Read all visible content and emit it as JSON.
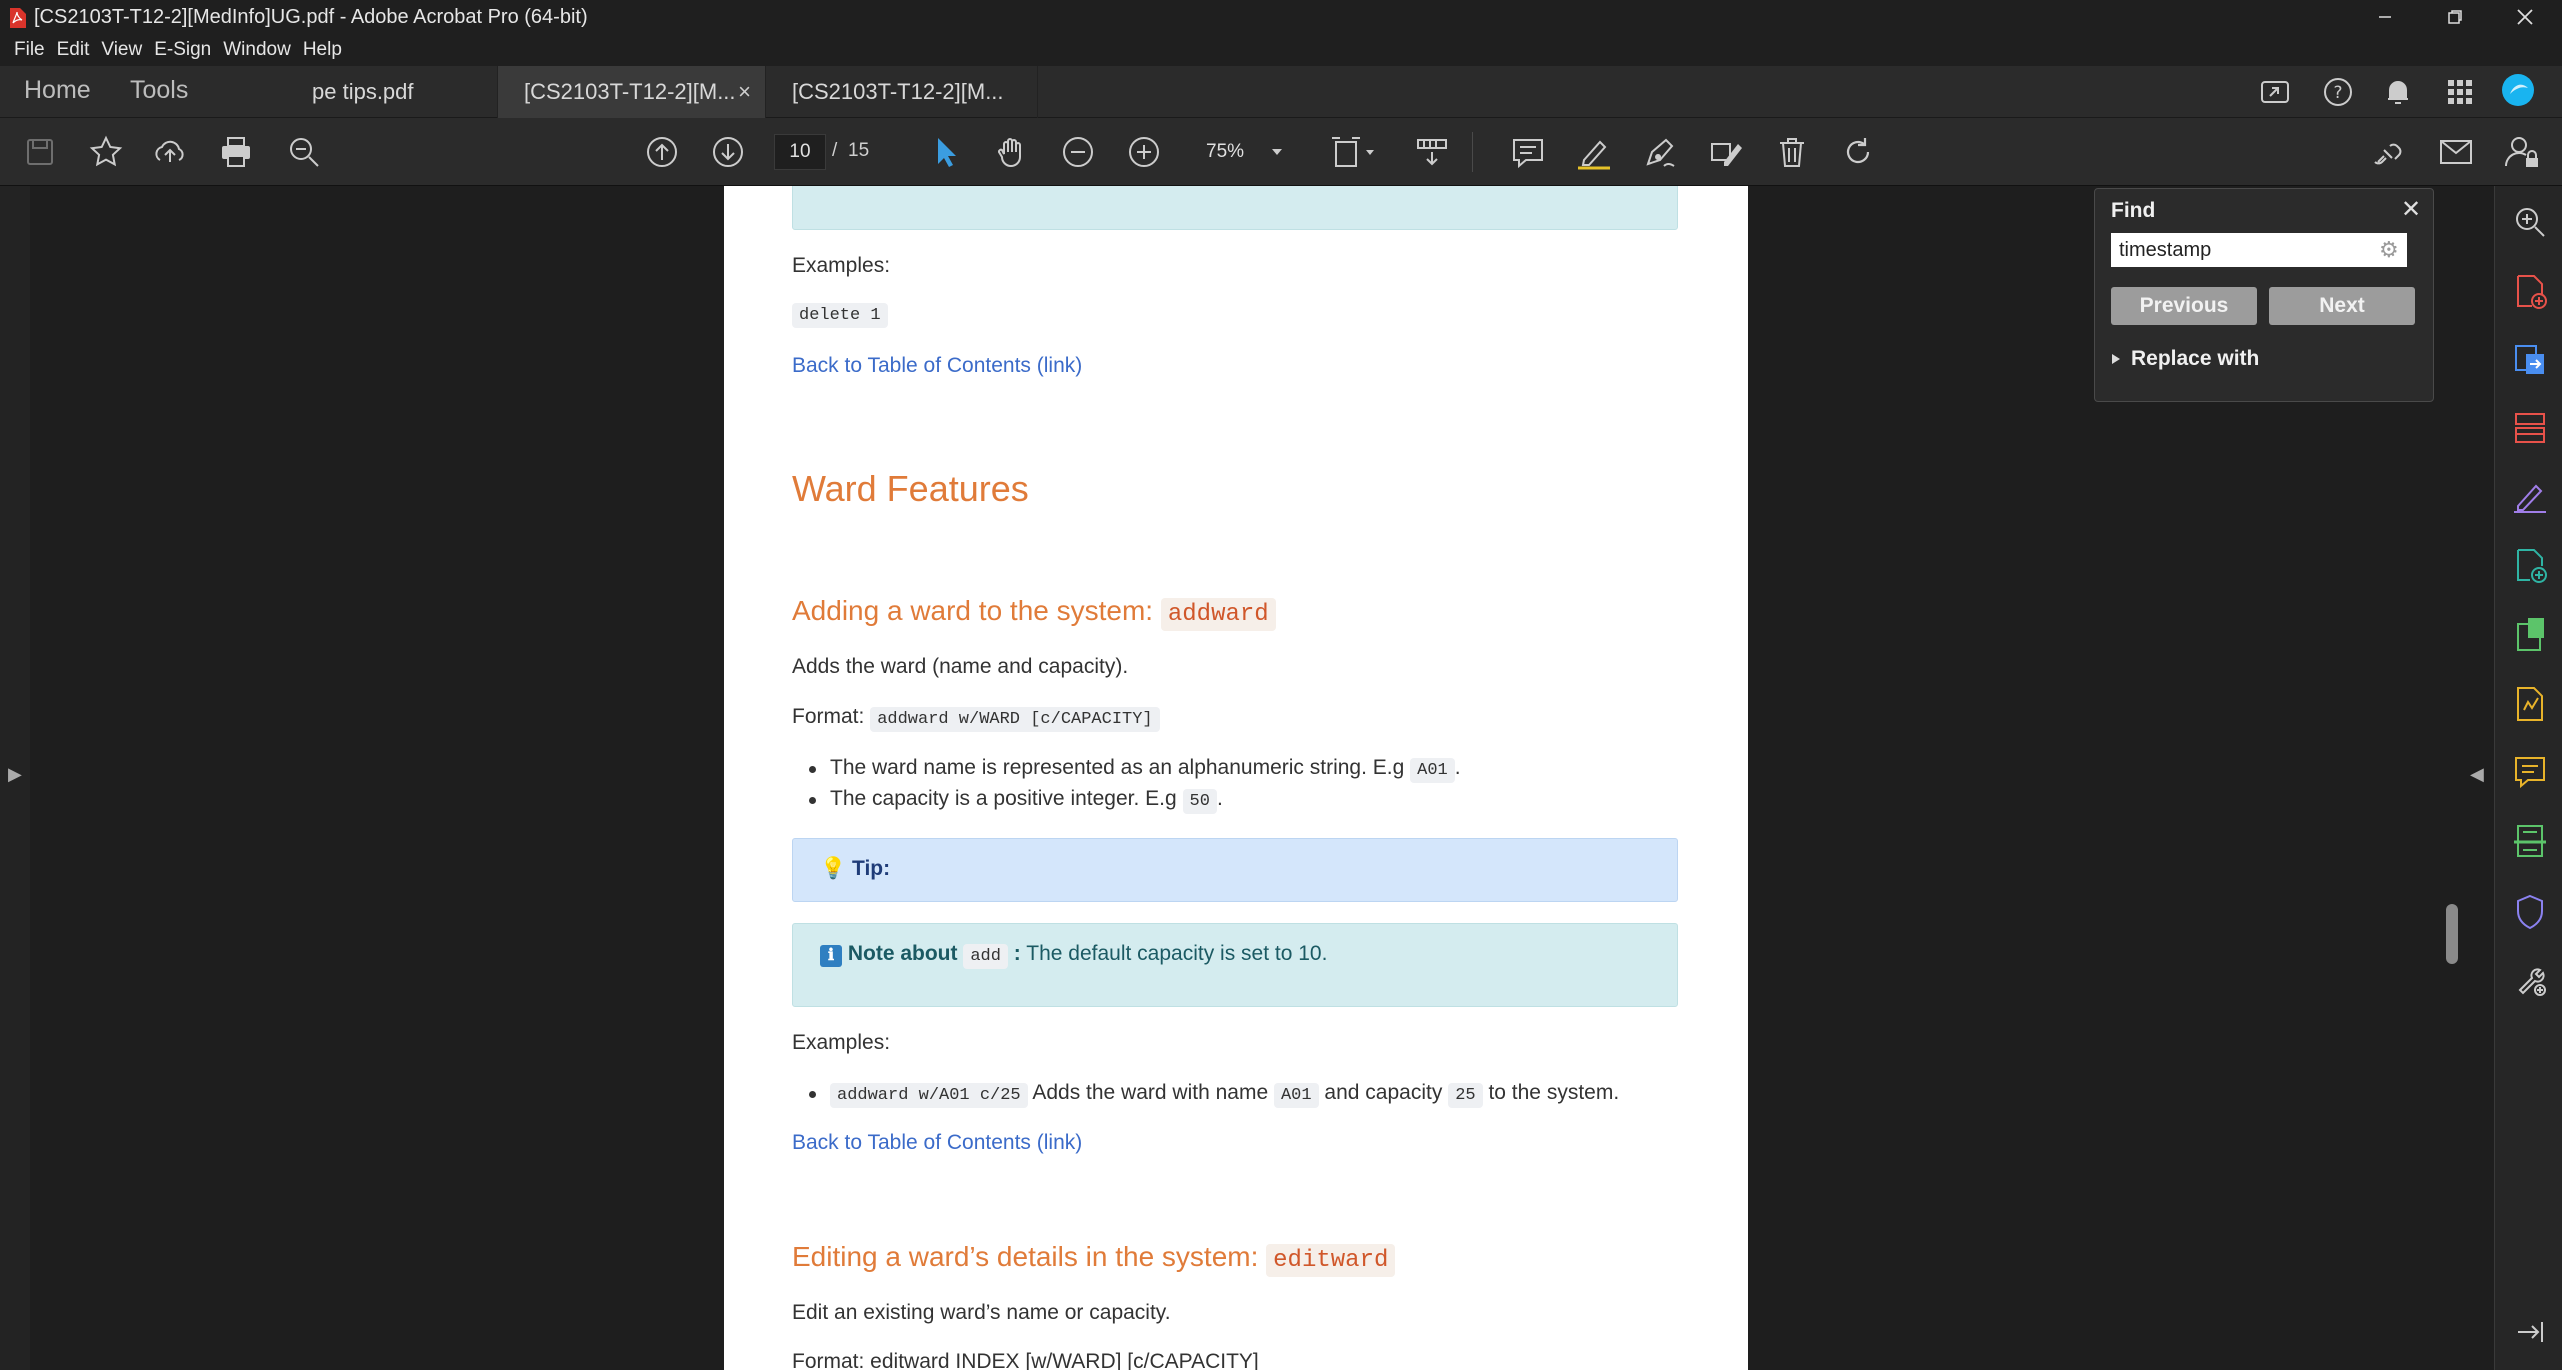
{
  "window": {
    "title": "[CS2103T-T12-2][MedInfo]UG.pdf - Adobe Acrobat Pro (64-bit)"
  },
  "menu": [
    "File",
    "Edit",
    "View",
    "E-Sign",
    "Window",
    "Help"
  ],
  "nav": {
    "home": "Home",
    "tools": "Tools"
  },
  "tabs": [
    {
      "label": "pe tips.pdf"
    },
    {
      "label": "[CS2103T-T12-2][M...",
      "close": "×"
    },
    {
      "label": "[CS2103T-T12-2][M..."
    }
  ],
  "toolbar": {
    "page_current": "10",
    "page_separator": "/",
    "page_total": "15",
    "zoom": "75%"
  },
  "find": {
    "title": "Find",
    "close": "✕",
    "query": "timestamp",
    "previous_label": "Previous",
    "next_label": "Next",
    "replace_label": "Replace with"
  },
  "document": {
    "examples_label_1": "Examples:",
    "delete_example": "delete 1",
    "back_link_1": "Back to Table of Contents (link)",
    "ward_features_heading": "Ward Features",
    "addward_heading_text": "Adding a ward to the system:",
    "addward_heading_code": "addward",
    "addward_desc": "Adds the ward (name and capacity).",
    "format_label": "Format:",
    "addward_format": "addward w/WARD [c/CAPACITY]",
    "bullet1_text": "The ward name is represented as an alphanumeric string. E.g",
    "bullet1_code": "A01",
    "bullet1_end": ".",
    "bullet2_text": "The capacity is a positive integer. E.g",
    "bullet2_code": "50",
    "bullet2_end": ".",
    "tip_icon": "💡",
    "tip_label": "Tip:",
    "note_icon": "ℹ",
    "note_label": "Note about",
    "note_code": "add",
    "note_colon": ":",
    "note_text": "The default capacity is set to 10.",
    "examples_label_2": "Examples:",
    "ex_code": "addward w/A01 c/25",
    "ex_text1": "Adds the ward with name",
    "ex_code2": "A01",
    "ex_text2": "and capacity",
    "ex_code3": "25",
    "ex_text3": "to the system.",
    "back_link_2": "Back to Table of Contents (link)",
    "editward_heading_text": "Editing a ward’s details in the system:",
    "editward_heading_code": "editward",
    "editward_desc": "Edit an existing ward’s name or capacity.",
    "editward_format_partial": "Format:  editward INDEX [w/WARD] [c/CAPACITY]"
  },
  "colors": {
    "heading": "#e07b39",
    "link": "#3b6bc9",
    "note_bg": "#d4ecef",
    "tip_bg": "#d4e6fb",
    "accent": "#19b4f0"
  }
}
